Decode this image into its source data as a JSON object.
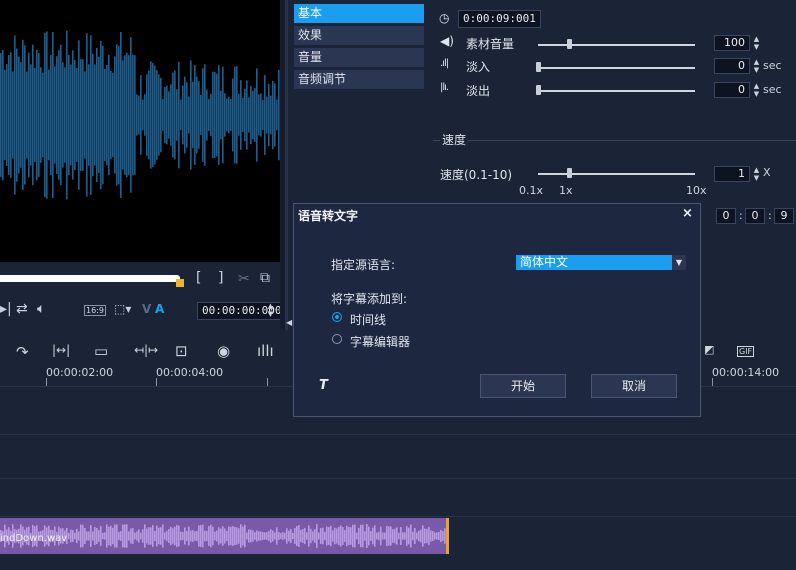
{
  "preview": {
    "timecode": "00:00:00:000",
    "aspect": "16:9",
    "mark_in": "[",
    "mark_out": "]"
  },
  "categories": [
    {
      "label": "基本"
    },
    {
      "label": "效果"
    },
    {
      "label": "音量"
    },
    {
      "label": "音频调节"
    }
  ],
  "properties": {
    "duration": "0:00:09:001",
    "rows": [
      {
        "label": "素材音量",
        "value": "100",
        "unit": "",
        "level": 0.2
      },
      {
        "label": "淡入",
        "value": "0",
        "unit": "sec",
        "level": 0.0
      },
      {
        "label": "淡出",
        "value": "0",
        "unit": "sec",
        "level": 0.0
      }
    ],
    "speed": {
      "group_label": "速度",
      "label": "速度(0.1-10)",
      "value": "1",
      "unit": "X",
      "tick_min": "0.1x",
      "tick_mid": "1x",
      "tick_max": "10x",
      "level": 0.2
    },
    "end_time": [
      "0",
      "0",
      "9"
    ]
  },
  "dialog": {
    "title": "语音转文字",
    "close": "×",
    "source_language_label": "指定源语言:",
    "source_language_value": "简体中文",
    "add_to_label": "将字幕添加到:",
    "options": [
      {
        "label": "时间线",
        "selected": true
      },
      {
        "label": "字幕编辑器",
        "selected": false
      }
    ],
    "start_button": "开始",
    "cancel_button": "取消"
  },
  "timeline": {
    "ruler": [
      "00:00:02:00",
      "00:00:04:00",
      "00:00:14:00"
    ],
    "clip_name": "indDown.wav",
    "gif_label": "GIF"
  },
  "colors": {
    "accent": "#1a9ff0",
    "background": "#1b2437",
    "waveform": "#1f5f8f",
    "clip": "#7a5aa8",
    "clip_edge": "#f0a030"
  }
}
